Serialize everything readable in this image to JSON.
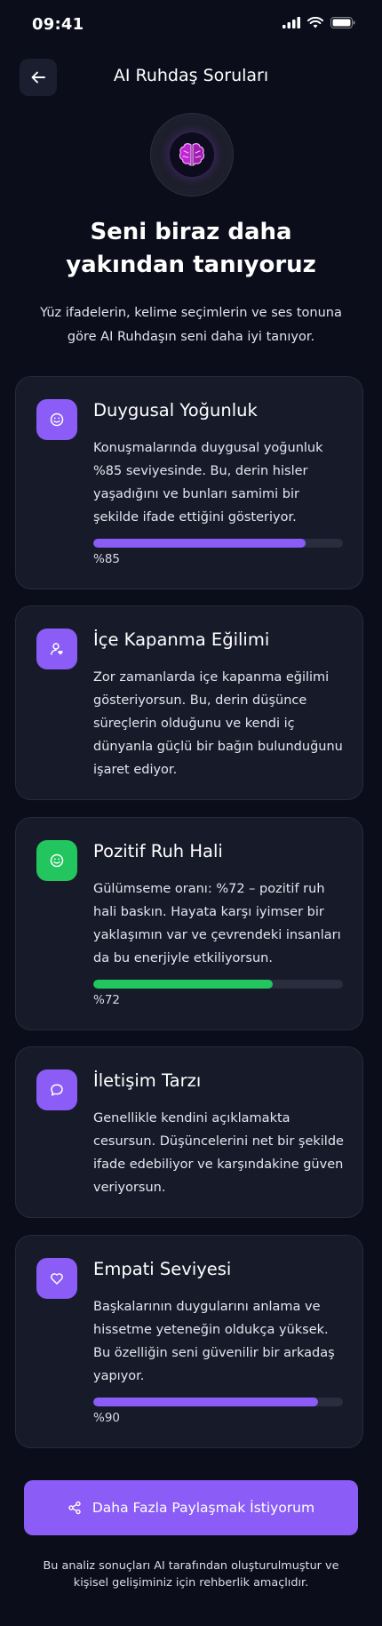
{
  "status_bar": {
    "time": "09:41"
  },
  "header": {
    "title": "AI Ruhdaş Soruları",
    "back_icon": "arrow-left-icon"
  },
  "hero": {
    "icon": "brain-icon",
    "title": "Seni biraz daha yakından tanıyoruz",
    "subtitle": "Yüz ifadelerin, kelime seçimlerin ve ses tonuna göre AI Ruhdaşın seni daha iyi tanıyor."
  },
  "cards": [
    {
      "title": "Duygusal Yoğunluk",
      "text": "Konuşmalarında duygusal yoğunluk %85 seviyesinde. Bu, derin hisler yaşadığını ve bunları samimi bir şekilde ifade ettiğini gösteriyor.",
      "icon": "smile-icon",
      "accent": "#8b5cf6",
      "progress": 0.85,
      "progress_label": "%85"
    },
    {
      "title": "İçe Kapanma Eğilimi",
      "text": "Zor zamanlarda içe kapanma eğilimi gösteriyorsun. Bu, derin düşünce süreçlerin olduğunu ve kendi iç dünyanla güçlü bir bağın bulunduğunu işaret ediyor.",
      "icon": "user-heart-icon",
      "accent": "#8b5cf6"
    },
    {
      "title": "Pozitif Ruh Hali",
      "text": "Gülümseme oranı: %72 – pozitif ruh hali baskın. Hayata karşı iyimser bir yaklaşımın var ve çevrendeki insanları da bu enerjiyle etkiliyorsun.",
      "icon": "smile-icon",
      "accent": "#22c55e",
      "progress": 0.72,
      "progress_label": "%72"
    },
    {
      "title": "İletişim Tarzı",
      "text": "Genellikle kendini açıklamakta cesursun. Düşüncelerini net bir şekilde ifade edebiliyor ve karşındakine güven veriyorsun.",
      "icon": "chat-bubble-icon",
      "accent": "#8b5cf6"
    },
    {
      "title": "Empati Seviyesi",
      "text": "Başkalarının duygularını anlama ve hissetme yeteneğin oldukça yüksek. Bu özelliğin seni güvenilir bir arkadaş yapıyor.",
      "icon": "heart-icon",
      "accent": "#8b5cf6",
      "progress": 0.9,
      "progress_label": "%90"
    }
  ],
  "cta": {
    "label": "Daha Fazla Paylaşmak İstiyorum",
    "icon": "share-icon"
  },
  "footer": {
    "note": "Bu analiz sonuçları AI tarafından oluşturulmuştur ve kişisel gelişiminiz için rehberlik amaçlıdır."
  }
}
